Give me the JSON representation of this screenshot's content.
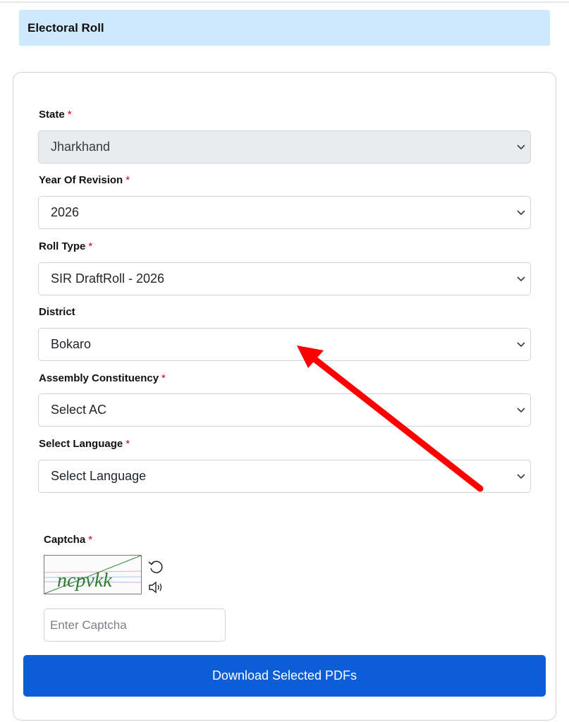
{
  "header": {
    "title": "Electoral Roll"
  },
  "form": {
    "required_mark": "*",
    "fields": [
      {
        "label": "State",
        "required": true,
        "value": "Jharkhand",
        "disabled": true
      },
      {
        "label": "Year Of Revision",
        "required": true,
        "value": "2026"
      },
      {
        "label": "Roll Type",
        "required": true,
        "value": "SIR DraftRoll - 2026"
      },
      {
        "label": "District",
        "required": false,
        "value": "Bokaro"
      },
      {
        "label": "Assembly Constituency",
        "required": true,
        "value": "Select AC"
      },
      {
        "label": "Select Language",
        "required": true,
        "value": "Select Language"
      }
    ],
    "captcha": {
      "label": "Captcha",
      "image_text": "ncpvkk",
      "refresh_icon": "refresh-icon",
      "audio_icon": "speaker-icon",
      "input_placeholder": "Enter Captcha"
    },
    "download_label": "Download Selected PDFs"
  },
  "colors": {
    "header_bg": "#cfe9fc",
    "primary": "#0b5ed7",
    "required": "#d0021b",
    "annotation_arrow": "#ff0000",
    "captcha_text": "#2e7d32"
  }
}
